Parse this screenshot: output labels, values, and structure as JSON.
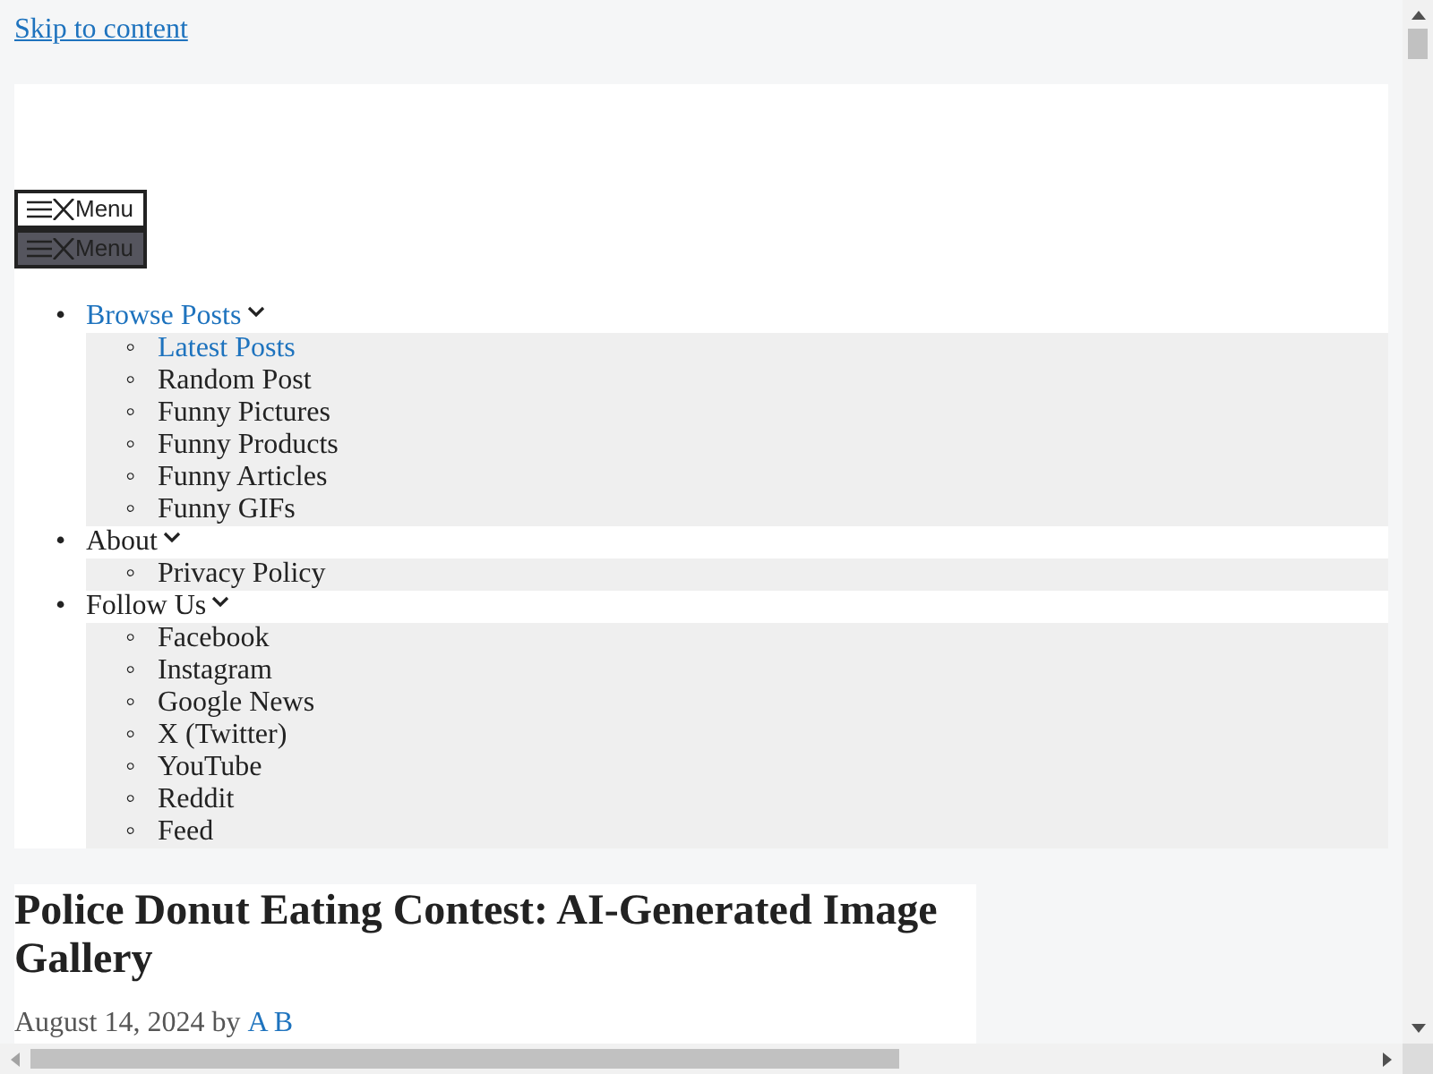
{
  "skip_link": "Skip to content",
  "menu_buttons": [
    {
      "label": "Menu",
      "kind": "normal"
    },
    {
      "label": "Menu",
      "kind": "pressed"
    }
  ],
  "nav": [
    {
      "marker": "•",
      "label": "Browse Posts",
      "selected": true,
      "children": [
        {
          "marker": "◦",
          "label": "Latest Posts",
          "selected": true
        },
        {
          "marker": "◦",
          "label": "Random Post",
          "selected": false
        },
        {
          "marker": "◦",
          "label": "Funny Pictures",
          "selected": false
        },
        {
          "marker": "◦",
          "label": "Funny Products",
          "selected": false
        },
        {
          "marker": "◦",
          "label": "Funny Articles",
          "selected": false
        },
        {
          "marker": "◦",
          "label": "Funny GIFs",
          "selected": false
        }
      ]
    },
    {
      "marker": "•",
      "label": "About",
      "selected": false,
      "children": [
        {
          "marker": "◦",
          "label": "Privacy Policy",
          "selected": false
        }
      ]
    },
    {
      "marker": "•",
      "label": "Follow Us",
      "selected": false,
      "children": [
        {
          "marker": "◦",
          "label": "Facebook",
          "selected": false
        },
        {
          "marker": "◦",
          "label": "Instagram",
          "selected": false
        },
        {
          "marker": "◦",
          "label": "Google News",
          "selected": false
        },
        {
          "marker": "◦",
          "label": "X (Twitter)",
          "selected": false
        },
        {
          "marker": "◦",
          "label": "YouTube",
          "selected": false
        },
        {
          "marker": "◦",
          "label": "Reddit",
          "selected": false
        },
        {
          "marker": "◦",
          "label": "Feed",
          "selected": false
        }
      ]
    }
  ],
  "article": {
    "title": "Police Donut Eating Contest: AI-Generated Image Gallery",
    "date": "August 14, 2024",
    "by": "by",
    "author": "A B"
  }
}
